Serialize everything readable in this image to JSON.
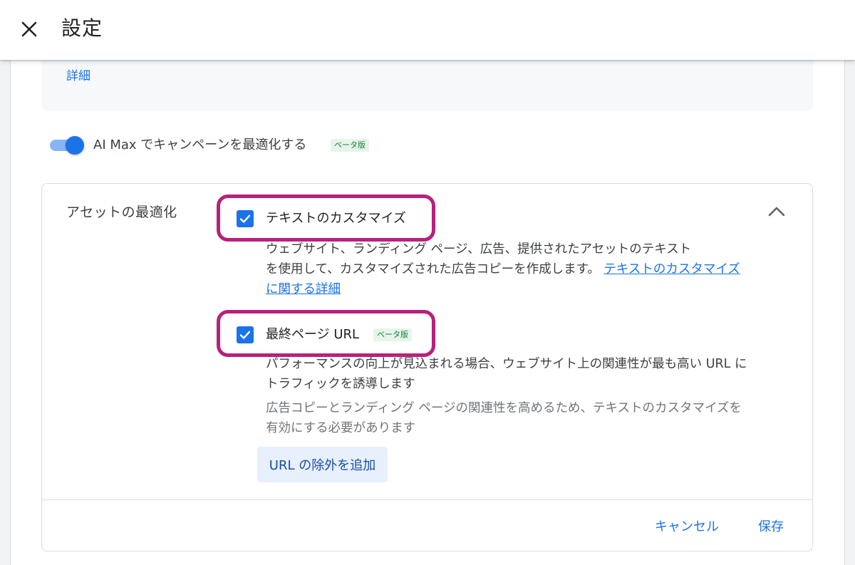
{
  "header": {
    "title": "設定",
    "close_icon": "close-icon"
  },
  "top_panel": {
    "details_link": "詳細"
  },
  "ai_max": {
    "toggle_on": true,
    "label": "AI Max でキャンペーンを最適化する",
    "badge": "ベータ版"
  },
  "asset_optimization": {
    "title": "アセットの最適化",
    "collapse_icon": "chevron-up-icon",
    "text_customization": {
      "checked": true,
      "label": "テキストのカスタマイズ",
      "description": "ウェブサイト、ランディング ページ、広告、提供されたアセットのテキスト",
      "description_2": "を使用して、カスタマイズされた広告コピーを作成します。",
      "link_text": "テキストのカスタマイズに関する詳細"
    },
    "final_url": {
      "checked": true,
      "label": "最終ページ URL",
      "badge": "ベータ版",
      "description": "パフォーマンスの向上が見込まれる場合、ウェブサイト上の関連性が最も高い URL にトラフィックを誘導します",
      "note": "広告コピーとランディング ページの関連性を高めるため、テキストのカスタマイズを有効にする必要があります",
      "url_exclusion_button": "URL の除外を追加"
    }
  },
  "footer": {
    "cancel_label": "キャンセル",
    "save_label": "保存"
  },
  "colors": {
    "accent": "#1a73e8",
    "highlight": "#b8217a",
    "beta_badge_bg": "#e6f4ea",
    "beta_badge_text": "#188038"
  }
}
